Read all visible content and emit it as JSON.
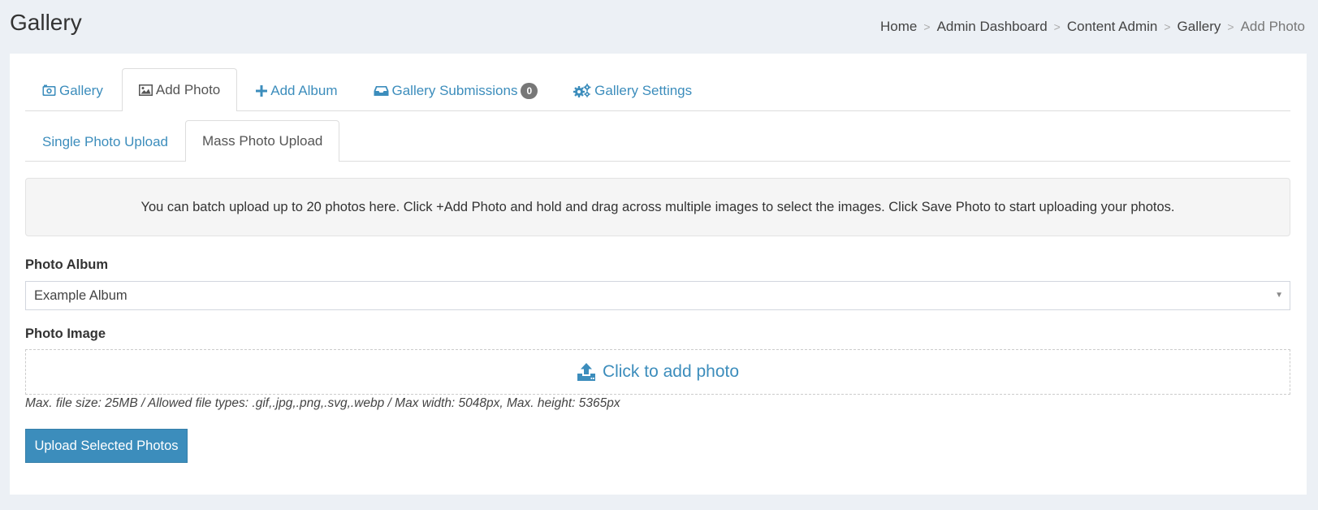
{
  "header": {
    "title": "Gallery",
    "breadcrumb": [
      "Home",
      "Admin Dashboard",
      "Content Admin",
      "Gallery",
      "Add Photo"
    ],
    "separator": ">"
  },
  "tabs": [
    {
      "label": "Gallery",
      "icon": "camera-icon"
    },
    {
      "label": "Add Photo",
      "icon": "image-icon",
      "active": true
    },
    {
      "label": "Add Album",
      "icon": "plus-icon"
    },
    {
      "label": "Gallery Submissions",
      "icon": "inbox-icon",
      "badge": "0"
    },
    {
      "label": "Gallery Settings",
      "icon": "gears-icon"
    }
  ],
  "subtabs": [
    {
      "label": "Single Photo Upload"
    },
    {
      "label": "Mass Photo Upload",
      "active": true
    }
  ],
  "info": "You can batch upload up to 20 photos here. Click +Add Photo and hold and drag across multiple images to select the images. Click Save Photo to start uploading your photos.",
  "form": {
    "album_label": "Photo Album",
    "album_value": "Example Album",
    "image_label": "Photo Image",
    "dropzone_label": "Click to add photo",
    "help": "Max. file size: 25MB / Allowed file types: .gif,.jpg,.png,.svg,.webp / Max width: 5048px, Max. height: 5365px",
    "submit_label": "Upload Selected Photos"
  },
  "colors": {
    "accent": "#3c8dbc",
    "background": "#ecf0f5",
    "badge": "#777777"
  }
}
